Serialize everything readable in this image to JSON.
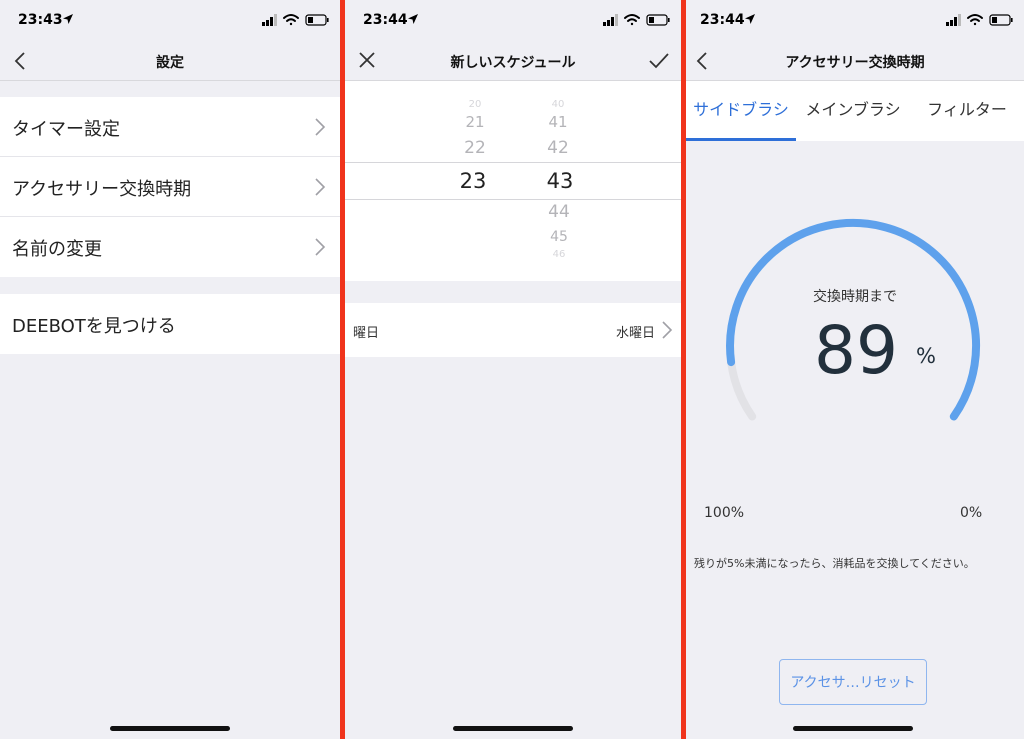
{
  "colors": {
    "accent": "#2e6fd8",
    "gauge_fill": "#5ea1ec",
    "gauge_track": "#e2e2e6",
    "divider": "#f0341c"
  },
  "panel1": {
    "time": "23:43",
    "nav": {
      "title": "設定",
      "left_icon": "back-chevron-icon"
    },
    "menu": [
      {
        "label": "タイマー設定",
        "icon": "chevron-right-icon"
      },
      {
        "label": "アクセサリー交換時期",
        "icon": "chevron-right-icon"
      },
      {
        "label": "名前の変更",
        "icon": "chevron-right-icon"
      }
    ],
    "find_label": "DEEBOTを見つける"
  },
  "panel2": {
    "time": "23:44",
    "nav": {
      "title": "新しいスケジュール",
      "left_icon": "close-icon",
      "right_icon": "checkmark-icon"
    },
    "picker": {
      "hours": [
        "20",
        "21",
        "22",
        "23"
      ],
      "selected_hour": "23",
      "minutes": [
        "40",
        "41",
        "42",
        "43",
        "44",
        "45",
        "46"
      ],
      "selected_minute": "43"
    },
    "weekday": {
      "label": "曜日",
      "value": "水曜日",
      "icon": "chevron-right-icon"
    }
  },
  "panel3": {
    "time": "23:44",
    "nav": {
      "title": "アクセサリー交換時期",
      "left_icon": "back-chevron-icon"
    },
    "tabs": [
      {
        "label": "サイドブラシ",
        "active": true
      },
      {
        "label": "メインブラシ",
        "active": false
      },
      {
        "label": "フィルター",
        "active": false
      }
    ],
    "gauge": {
      "caption": "交換時期まで",
      "value": 89,
      "value_text": "89",
      "unit": "%",
      "min_label": "100%",
      "max_label": "0%"
    },
    "note": "残りが5%未満になったら、消耗品を交換してください。",
    "reset_label": "アクセサ…リセット"
  }
}
